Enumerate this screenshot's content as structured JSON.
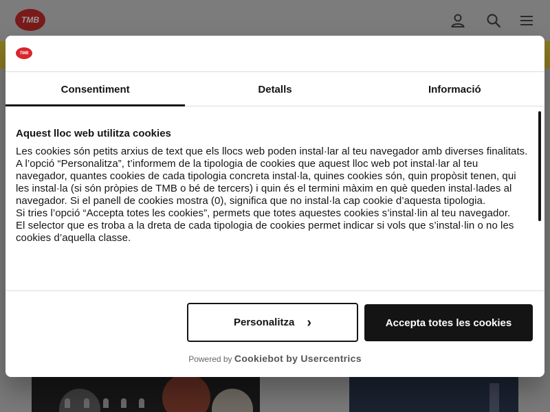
{
  "site": {
    "logo_text": "TMB"
  },
  "dialog": {
    "logo_text": "TMB",
    "tabs": [
      {
        "label": "Consentiment",
        "active": true
      },
      {
        "label": "Detalls",
        "active": false
      },
      {
        "label": "Informació",
        "active": false
      }
    ],
    "title": "Aquest lloc web utilitza cookies",
    "paragraphs": [
      "Les cookies són petits arxius de text que els llocs web poden instal·lar al teu navegador amb diverses finalitats.",
      "A l’opció “Personalitza”, t’informem de la tipologia de cookies que aquest lloc web pot instal·lar al teu navegador, quantes cookies de cada tipologia concreta instal·la, quines cookies són, quin propòsit tenen, qui les instal·la (si són pròpies de TMB o bé de tercers) i quin és el termini màxim en què queden instal·lades al navegador. Si el panell de cookies mostra (0), significa que no instal·la cap cookie d’aquesta tipologia.",
      "Si tries l’opció “Accepta totes les cookies”, permets que totes aquestes cookies s’instal·lin al teu navegador.",
      "El selector que es troba a la dreta de cada tipologia de cookies permet indicar si vols que s’instal·lin o no les cookies d’aquella classe."
    ],
    "buttons": {
      "personalize": "Personalitza",
      "personalize_chevron": "›",
      "accept_all": "Accepta totes les cookies"
    },
    "powered_by": {
      "prefix": "Powered by",
      "brand": "Cookiebot by Usercentrics"
    }
  },
  "colors": {
    "brand_red": "#d8262c",
    "primary_dark": "#141414"
  }
}
